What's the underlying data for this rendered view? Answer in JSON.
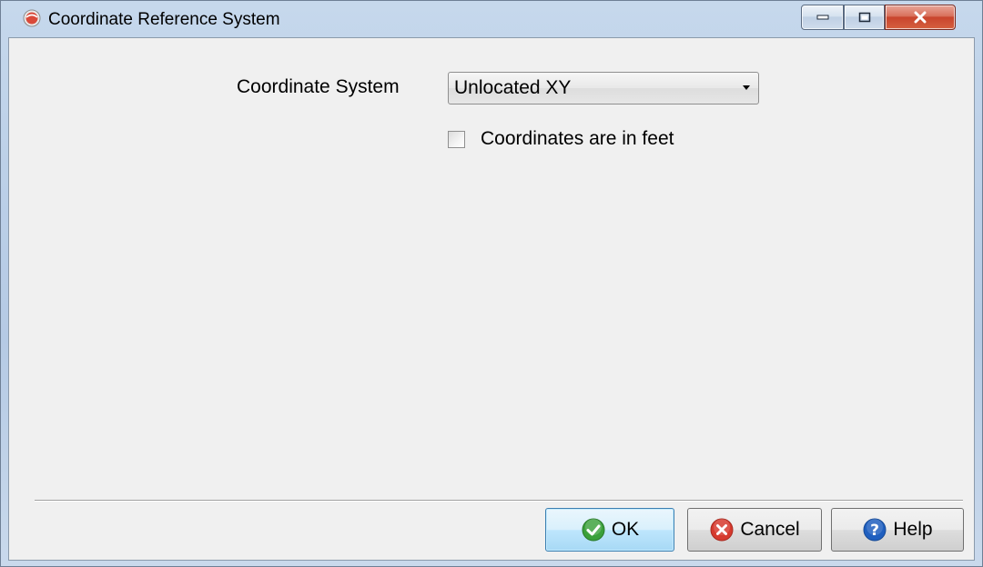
{
  "window": {
    "title": "Coordinate Reference System"
  },
  "form": {
    "coordinate_system_label": "Coordinate System",
    "coordinate_system_value": "Unlocated XY",
    "feet_checkbox_label": "Coordinates are in feet",
    "feet_checkbox_checked": false
  },
  "buttons": {
    "ok_label": "OK",
    "cancel_label": "Cancel",
    "help_label": "Help"
  },
  "icons": {
    "app": "app-globe-icon",
    "ok": "check-circle-icon",
    "cancel": "x-circle-icon",
    "help": "question-circle-icon"
  },
  "colors": {
    "ok_icon": "#3aa03a",
    "cancel_icon": "#d63a2e",
    "help_icon": "#1f5fbf",
    "close_button": "#c8452d"
  }
}
